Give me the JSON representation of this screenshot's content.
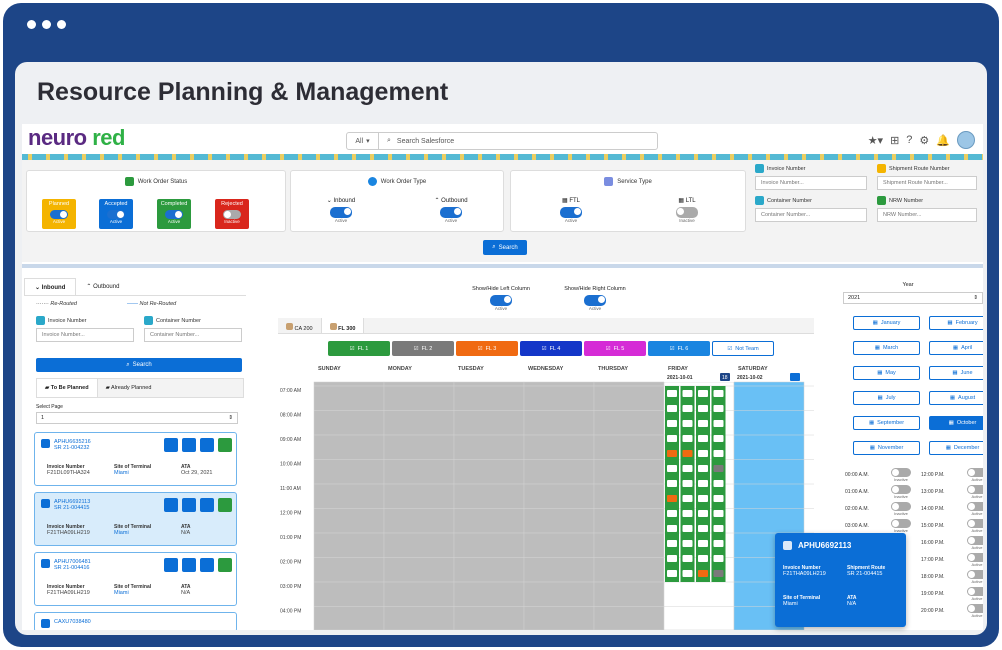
{
  "page_title": "Resource Planning & Management",
  "logo": {
    "part1": "neuro",
    "part2": "red"
  },
  "header": {
    "scope": "All",
    "search_placeholder": "Search Salesforce"
  },
  "work_order_status": {
    "title": "Work Order Status",
    "items": [
      {
        "label": "Planned",
        "state": "Active",
        "color": "#f4b400"
      },
      {
        "label": "Accepted",
        "state": "Active",
        "color": "#0b6ed6"
      },
      {
        "label": "Completed",
        "state": "Active",
        "color": "#2c9a3e"
      },
      {
        "label": "Rejected",
        "state": "Inactive",
        "color": "#d9261c"
      }
    ]
  },
  "work_order_type": {
    "title": "Work Order Type",
    "items": [
      {
        "label": "Inbound",
        "state": "Active"
      },
      {
        "label": "Outbound",
        "state": "Active"
      }
    ]
  },
  "service_type": {
    "title": "Service Type",
    "items": [
      {
        "label": "FTL",
        "state": "Active"
      },
      {
        "label": "LTL",
        "state": "Inactive"
      }
    ]
  },
  "search_fields": {
    "invoice": {
      "label": "Invoice Number",
      "placeholder": "Invoice Number..."
    },
    "shipment_route": {
      "label": "Shipment Route Number",
      "placeholder": "Shipment Route Number..."
    },
    "container": {
      "label": "Container Number",
      "placeholder": "Container Number..."
    },
    "nrw": {
      "label": "NRW Number",
      "placeholder": "NRW Number..."
    }
  },
  "search_button": "Search",
  "left_panel": {
    "tabs": [
      "Inbound",
      "Outbound"
    ],
    "legend": {
      "rerouted": "Re-Routed",
      "not_rerouted": "Not Re-Routed"
    },
    "invoice_label": "Invoice Number",
    "invoice_placeholder": "Invoice Number...",
    "container_label": "Container Number",
    "container_placeholder": "Container Number...",
    "search": "Search",
    "subtabs": [
      "To Be Planned",
      "Already Planned"
    ],
    "select_page_label": "Select Page",
    "select_page_value": "1",
    "col_invoice": "Invoice Number",
    "col_site": "Site of Terminal",
    "col_ata": "ATA",
    "shipments": [
      {
        "id": "APHU6635216",
        "sr": "SR 21-004232",
        "invoice": "F21DL09THA324",
        "site": "Miami",
        "ata": "Oct 29, 2021"
      },
      {
        "id": "APHU6692113",
        "sr": "SR 21-004415",
        "invoice": "F21THA09LH219",
        "site": "Miami",
        "ata": "N/A"
      },
      {
        "id": "APHU7006481",
        "sr": "SR 21-004416",
        "invoice": "F21THA09LH219",
        "site": "Miami",
        "ata": "N/A"
      },
      {
        "id": "CAXU7038480"
      }
    ]
  },
  "middle": {
    "toggle_left": "Show/Hide Left Column",
    "toggle_right": "Show/Hide Right Column",
    "toggle_state": "Active",
    "locations": [
      "CA 200",
      "FL 300"
    ],
    "teams": [
      {
        "name": "FL 1",
        "color": "#2c9a3e"
      },
      {
        "name": "FL 2",
        "color": "#7a7a7a"
      },
      {
        "name": "FL 3",
        "color": "#f06a12"
      },
      {
        "name": "FL 4",
        "color": "#1436c8"
      },
      {
        "name": "FL 5",
        "color": "#d52bd6"
      },
      {
        "name": "FL 6",
        "color": "#1a85e0"
      },
      {
        "name": "Not Team",
        "color": "#ffffff"
      }
    ],
    "days": [
      "SUNDAY",
      "MONDAY",
      "TUESDAY",
      "WEDNESDAY",
      "THURSDAY",
      "FRIDAY",
      "SATURDAY"
    ],
    "friday_date": "2021-10-01",
    "friday_badge": "18",
    "saturday_date": "2021-10-02",
    "times": [
      "07:00 AM",
      "08:00 AM",
      "09:00 AM",
      "10:00 AM",
      "11:00 AM",
      "12:00 PM",
      "01:00 PM",
      "02:00 PM",
      "03:00 PM",
      "04:00 PM"
    ]
  },
  "popup": {
    "title": "APHU6692113",
    "invoice_label": "Invoice Number",
    "invoice_value": "F21THA09LH219",
    "route_label": "Shipment Route",
    "route_value": "SR 21-004415",
    "site_label": "Site of Terminal",
    "site_value": "Miami",
    "ata_label": "ATA",
    "ata_value": "N/A"
  },
  "right_panel": {
    "year_label": "Year",
    "year_value": "2021",
    "months": [
      "January",
      "February",
      "March",
      "April",
      "May",
      "June",
      "July",
      "August",
      "September",
      "October",
      "November",
      "December"
    ],
    "selected_month": "October",
    "am_times": [
      "00:00 A.M.",
      "01:00 A.M.",
      "02:00 A.M.",
      "03:00 A.M."
    ],
    "pm_times": [
      "12:00 P.M.",
      "13:00 P.M.",
      "14:00 P.M.",
      "15:00 P.M.",
      "16:00 P.M.",
      "17:00 P.M.",
      "18:00 P.M.",
      "19:00 P.M.",
      "20:00 P.M."
    ],
    "inactive": "Inactive",
    "active": "Active"
  }
}
